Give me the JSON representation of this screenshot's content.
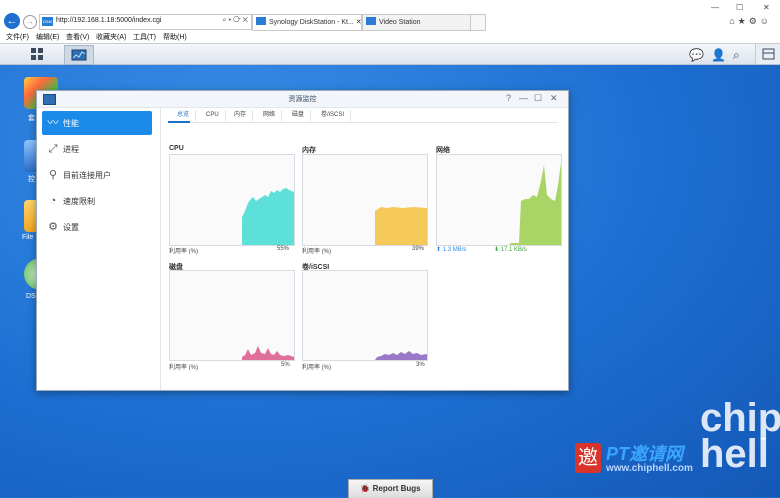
{
  "browser": {
    "url": "http://192.168.1.18:5000/index.cgi",
    "tabs": [
      {
        "label": "Synology DiskStation - Kt...",
        "active": true
      },
      {
        "label": "Video Station",
        "active": false
      }
    ],
    "window_controls": [
      "—",
      "☐",
      "✕"
    ],
    "menu": [
      "文件(F)",
      "编辑(E)",
      "查看(V)",
      "收藏夹(A)",
      "工具(T)",
      "帮助(H)"
    ]
  },
  "desktop": {
    "labels": [
      "套",
      "控",
      "File",
      "DS"
    ]
  },
  "window": {
    "title": "资源监控",
    "controls": [
      "?",
      "—",
      "☐",
      "✕"
    ],
    "sidebar": [
      {
        "label": "性能",
        "icon": "performance-icon",
        "active": true
      },
      {
        "label": "进程",
        "icon": "process-icon",
        "active": false
      },
      {
        "label": "目前连接用户",
        "icon": "connected-users-icon",
        "active": false
      },
      {
        "label": "速度限制",
        "icon": "speed-limit-icon",
        "active": false
      },
      {
        "label": "设置",
        "icon": "settings-icon",
        "active": false
      }
    ],
    "tabs": [
      "总览",
      "CPU",
      "内存",
      "网络",
      "磁盘",
      "卷/iSCSI"
    ],
    "active_tab": "总览",
    "panels": {
      "cpu": {
        "title": "CPU",
        "footer_label": "利用率 (%)",
        "value": "55%",
        "color": "#5ce0d8"
      },
      "memory": {
        "title": "内存",
        "footer_label": "利用率 (%)",
        "value": "39%",
        "color": "#f5c85a"
      },
      "network": {
        "title": "网络",
        "up": "1.3 MB/s",
        "down": "17.1 KB/s",
        "color": "#a9d566",
        "up_color": "#2a8ae0",
        "down_color": "#3aa53a"
      },
      "disk": {
        "title": "磁盘",
        "footer_label": "利用率 (%)",
        "value": "5%",
        "color": "#e0709a"
      },
      "volume": {
        "title": "卷/iSCSI",
        "footer_label": "利用率 (%)",
        "value": "3%",
        "color": "#9a78c8"
      }
    }
  },
  "bottom": {
    "report_label": "Report Bugs"
  },
  "watermark": {
    "chip": "chip",
    "hell": "hell",
    "seal": "邀",
    "pt": "PT邀请网",
    "site": "www.chiphell.com"
  }
}
